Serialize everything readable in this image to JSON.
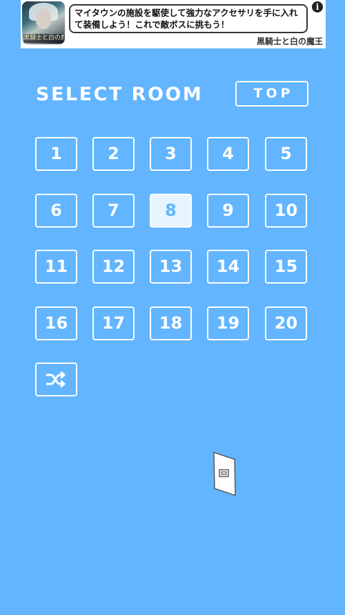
{
  "ad": {
    "thumb_caption": "黒騎士と白の魔王",
    "message": "マイタウンの施設を駆使して強力なアクセサリを手に入れて装備しよう！これで敵ボスに挑もう！",
    "info_label": "i",
    "brand": "黒騎士と白の魔王"
  },
  "header": {
    "title": "SELECT ROOM",
    "top_button": "TOP"
  },
  "rooms": [
    "1",
    "2",
    "3",
    "4",
    "5",
    "6",
    "7",
    "8",
    "9",
    "10",
    "11",
    "12",
    "13",
    "14",
    "15",
    "16",
    "17",
    "18",
    "19",
    "20"
  ],
  "selected_room": "8",
  "icons": {
    "shuffle": "shuffle-icon",
    "light_switch": "light-switch-icon",
    "info": "info-icon"
  },
  "colors": {
    "background": "#62b5fe",
    "selected_fill": "#e6f4ff",
    "outline": "#ffffff"
  }
}
